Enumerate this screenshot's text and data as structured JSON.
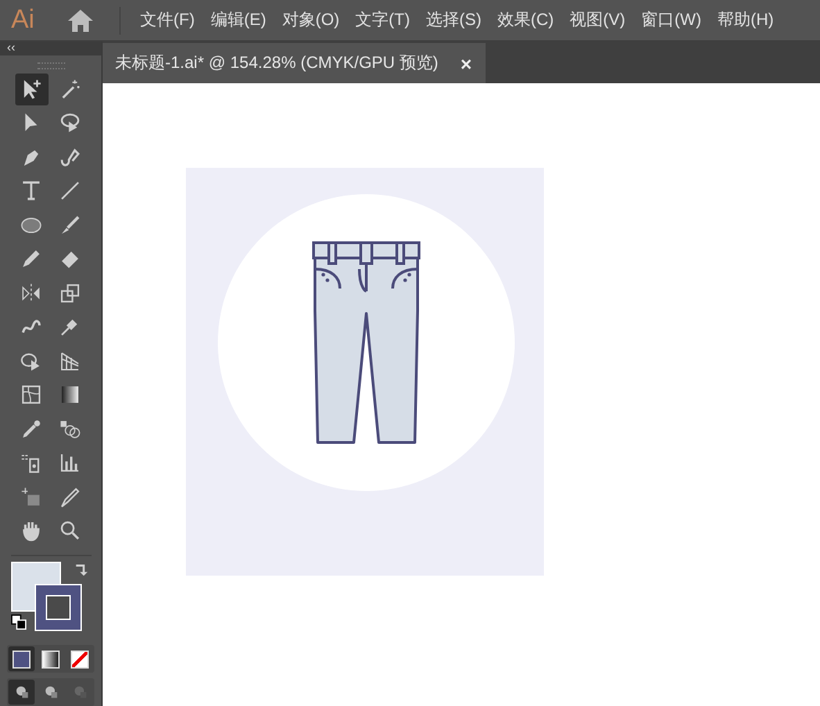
{
  "app": {
    "logo": "Ai"
  },
  "menu": [
    "文件(F)",
    "编辑(E)",
    "对象(O)",
    "文字(T)",
    "选择(S)",
    "效果(C)",
    "视图(V)",
    "窗口(W)",
    "帮助(H)"
  ],
  "document_tab": {
    "title": "未标题-1.ai* @ 154.28% (CMYK/GPU 预览)",
    "close": "×"
  },
  "toolbar": {
    "collapse": "‹‹",
    "tools": [
      {
        "selected": true
      },
      {
        "selected": false
      },
      {
        "selected": false
      },
      {
        "selected": false
      },
      {
        "selected": false
      },
      {
        "selected": false
      },
      {
        "selected": false
      },
      {
        "selected": false
      },
      {
        "selected": false
      },
      {
        "selected": false
      },
      {
        "selected": false
      },
      {
        "selected": false
      },
      {
        "selected": false
      },
      {
        "selected": false
      },
      {
        "selected": false
      },
      {
        "selected": false
      },
      {
        "selected": false
      },
      {
        "selected": false
      },
      {
        "selected": false
      },
      {
        "selected": false
      },
      {
        "selected": false
      },
      {
        "selected": false
      },
      {
        "selected": false
      },
      {
        "selected": false
      },
      {
        "selected": false
      },
      {
        "selected": false
      },
      {
        "selected": false
      },
      {
        "selected": false
      }
    ],
    "draw_modes": [
      {
        "selected": true
      },
      {
        "selected": false
      },
      {
        "selected": false
      }
    ],
    "screen_modes": [
      {
        "selected": true
      },
      {
        "selected": false
      },
      {
        "selected": false
      }
    ]
  }
}
